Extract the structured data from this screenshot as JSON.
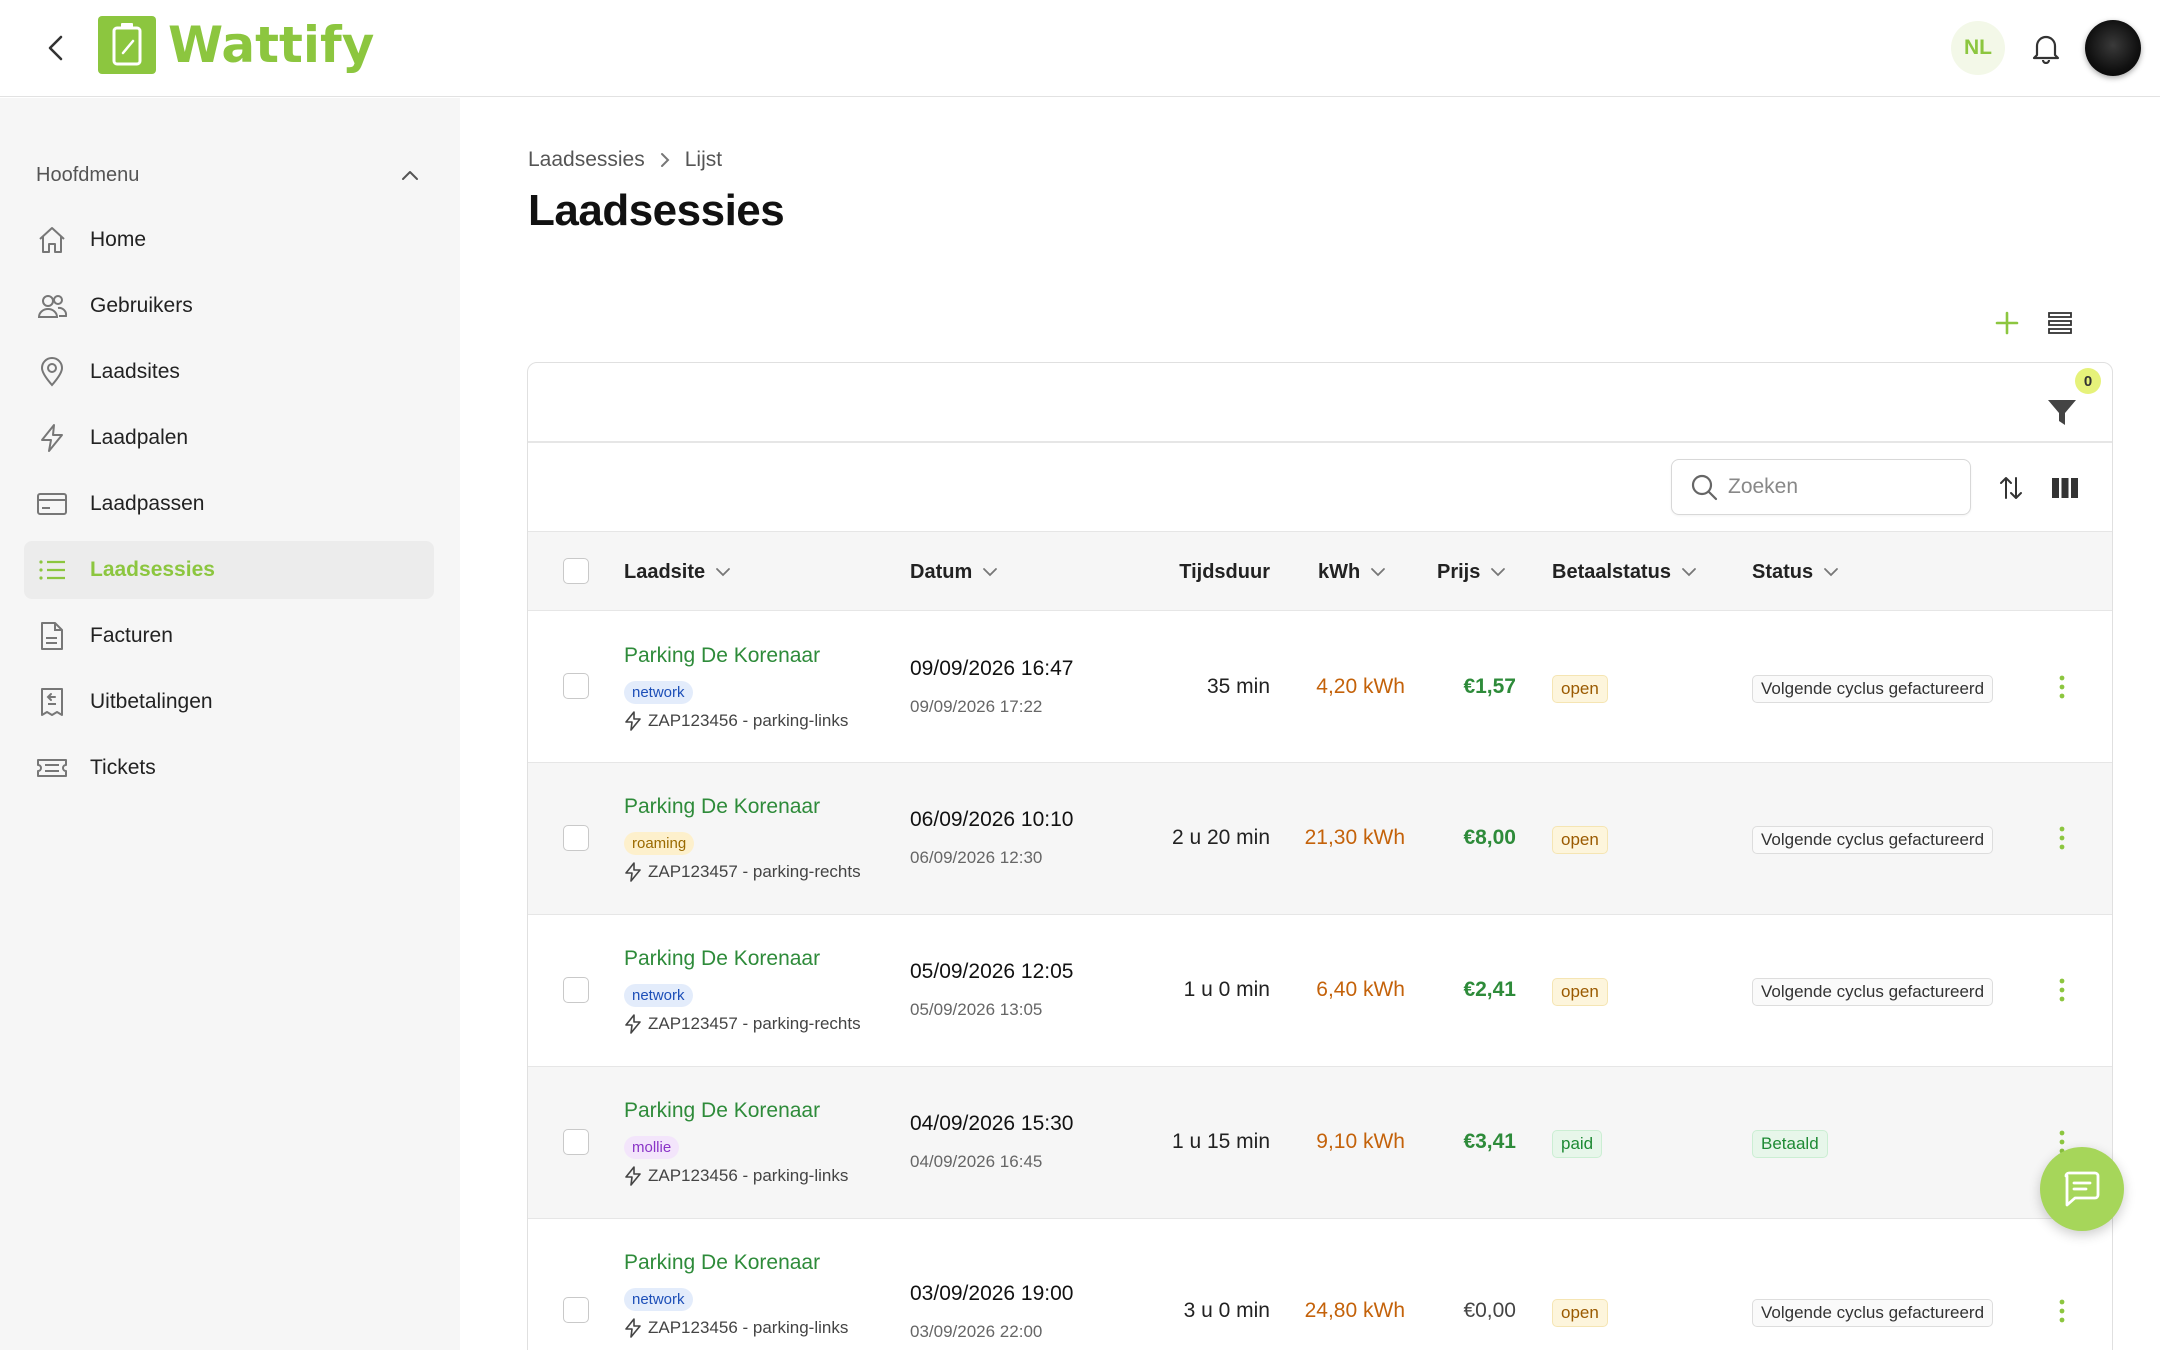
{
  "header": {
    "brand": "Wattify",
    "language": "NL",
    "colors": {
      "accent": "#8cc63f",
      "link": "#2e8b3a",
      "energy": "#c4620a"
    }
  },
  "sidebar": {
    "section_title": "Hoofdmenu",
    "items": [
      {
        "label": "Home",
        "icon": "home-icon"
      },
      {
        "label": "Gebruikers",
        "icon": "users-icon"
      },
      {
        "label": "Laadsites",
        "icon": "location-pin-icon"
      },
      {
        "label": "Laadpalen",
        "icon": "bolt-icon"
      },
      {
        "label": "Laadpassen",
        "icon": "card-icon"
      },
      {
        "label": "Laadsessies",
        "icon": "list-icon",
        "active": true
      },
      {
        "label": "Facturen",
        "icon": "document-icon"
      },
      {
        "label": "Uitbetalingen",
        "icon": "payout-icon"
      },
      {
        "label": "Tickets",
        "icon": "ticket-icon"
      }
    ]
  },
  "breadcrumb": {
    "parent": "Laadsessies",
    "current": "Lijst"
  },
  "page": {
    "title": "Laadsessies"
  },
  "filters": {
    "active_count": "0"
  },
  "search": {
    "placeholder": "Zoeken",
    "value": ""
  },
  "table": {
    "columns": {
      "site": "Laadsite",
      "date": "Datum",
      "duration": "Tijdsduur",
      "kwh": "kWh",
      "price": "Prijs",
      "payment_status": "Betaalstatus",
      "status": "Status"
    },
    "rows": [
      {
        "site": "Parking De Korenaar",
        "tag": "network",
        "charger": "ZAP123456 - parking-links",
        "start": "09/09/2026 16:47",
        "end": "09/09/2026 17:22",
        "duration": "35 min",
        "kwh": "4,20 kWh",
        "price": "€1,57",
        "payment": "open",
        "status": "Volgende cyclus gefactureerd"
      },
      {
        "site": "Parking De Korenaar",
        "tag": "roaming",
        "charger": "ZAP123457 - parking-rechts",
        "start": "06/09/2026 10:10",
        "end": "06/09/2026 12:30",
        "duration": "2 u 20 min",
        "kwh": "21,30 kWh",
        "price": "€8,00",
        "payment": "open",
        "status": "Volgende cyclus gefactureerd"
      },
      {
        "site": "Parking De Korenaar",
        "tag": "network",
        "charger": "ZAP123457 - parking-rechts",
        "start": "05/09/2026 12:05",
        "end": "05/09/2026 13:05",
        "duration": "1 u 0 min",
        "kwh": "6,40 kWh",
        "price": "€2,41",
        "payment": "open",
        "status": "Volgende cyclus gefactureerd"
      },
      {
        "site": "Parking De Korenaar",
        "tag": "mollie",
        "charger": "ZAP123456 - parking-links",
        "start": "04/09/2026 15:30",
        "end": "04/09/2026 16:45",
        "duration": "1 u 15 min",
        "kwh": "9,10 kWh",
        "price": "€3,41",
        "payment": "paid",
        "status": "Betaald"
      },
      {
        "site": "Parking De Korenaar",
        "tag": "network",
        "charger": "ZAP123456 - parking-links",
        "start": "03/09/2026 19:00",
        "end": "03/09/2026 22:00",
        "duration": "3 u 0 min",
        "kwh": "24,80 kWh",
        "price": "€0,00",
        "payment": "open",
        "status": "Volgende cyclus gefactureerd"
      }
    ]
  }
}
